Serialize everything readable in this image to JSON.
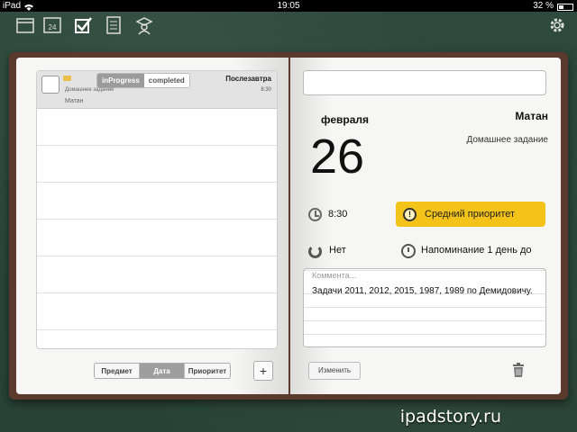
{
  "statusbar": {
    "device": "iPad",
    "time": "19:05",
    "battery": "32 %"
  },
  "toolbar": {
    "icons": [
      "calendar-icon",
      "date-24-icon",
      "checklist-icon",
      "notes-icon",
      "teacher-icon",
      "settings-gear-icon"
    ],
    "calendar_day": "24"
  },
  "list": {
    "task": {
      "status_tabs": [
        "inProgress",
        "completed"
      ],
      "date": "Послезавтра",
      "type": "Домашнее задание",
      "time": "8:30",
      "subject": "Матан"
    },
    "sort": {
      "options": [
        "Предмет",
        "Дата",
        "Приоритет"
      ],
      "active": "Дата"
    },
    "add": "+"
  },
  "detail": {
    "month": "февраля",
    "day": "26",
    "subject": "Матан",
    "type": "Домашнее задание",
    "time": "8:30",
    "priority": "Средний приоритет",
    "repeat": "Нет",
    "reminder": "Напоминание 1 день до",
    "comment_placeholder": "Коммента...",
    "comment": "Задачи 2011, 2012, 2015, 1987, 1989 по Демидовичу.",
    "edit": "Изменить"
  },
  "watermark": "ipadstory.ru",
  "colors": {
    "board": "#2e4a3c",
    "priority": "#f4c31a",
    "cover": "#5a3a2c"
  }
}
